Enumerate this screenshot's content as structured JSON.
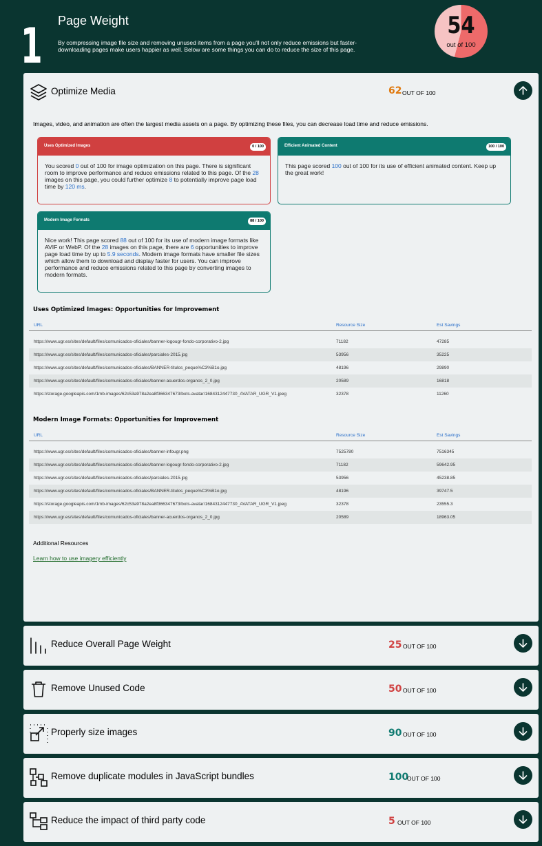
{
  "hero": {
    "number": "1",
    "title": "Page Weight",
    "description": "By compressing image file size and removing unused items from a page you'll not only reduce emissions but faster-downloading pages make users happier as well. Below are some things you can do to reduce the size of this page.",
    "score": "54",
    "score_out_of": "out of 100",
    "score_fraction": 0.54
  },
  "optimize_media": {
    "title": "Optimize Media",
    "score": "62",
    "out_of": "OUT OF 100",
    "intro": "Images, video, and animation are often the largest media assets on a page. By optimizing these files, you can decrease load time and reduce emissions.",
    "cards": [
      {
        "title": "Uses Optimized Images",
        "badge": "0 / 100",
        "parts": [
          "You scored ",
          "0",
          " out of 100 for image optimization on this page. There is significant room to improve performance and reduce emissions related to this page. Of the ",
          "28",
          " images on this page, you could further optimize ",
          "8",
          " to potentially improve page load time by ",
          "120 ms",
          "."
        ]
      },
      {
        "title": "Efficient Animated Content",
        "badge": "100 / 100",
        "parts": [
          "This page scored ",
          "100",
          " out of 100 for its use of efficient animated content. Keep up the great work!"
        ]
      },
      {
        "title": "Modern Image Formats",
        "badge": "88 / 100",
        "parts": [
          "Nice work! This page scored ",
          "88",
          " out of 100 for its use of modern image formats like AVIF or WebP. Of the ",
          "28",
          " images on this page, there are ",
          "6",
          " opportunities to improve page load time by up to ",
          "5.9 seconds",
          ". Modern image formats have smaller file sizes which allow them to download and display faster for users. You can improve performance and reduce emissions related to this page by converting images to modern formats."
        ]
      }
    ],
    "table1": {
      "title": "Uses Optimized Images: Opportunities for Improvement",
      "headers": [
        "URL",
        "Resource Size",
        "Est Savings"
      ],
      "rows": [
        [
          "https://www.ugr.es/sites/default/files/comunicados-oficiales/banner-logougr-fondo-corporativo-2.jpg",
          "71182",
          "47285"
        ],
        [
          "https://www.ugr.es/sites/default/files/comunicados-oficiales/parciales-2015.jpg",
          "53956",
          "35225"
        ],
        [
          "https://www.ugr.es/sites/default/files/comunicados-oficiales/BANNER-titulos_peque%C3%B1o.jpg",
          "48196",
          "29890"
        ],
        [
          "https://www.ugr.es/sites/default/files/comunicados-oficiales/banner-acuerdos-organos_2_0.jpg",
          "20589",
          "16818"
        ],
        [
          "https://storage.googleapis.com/1mb-images/62c53a978a2ea8f366347673/bots-avatar/1684312447730_AVATAR_UGR_V1.jpeg",
          "32378",
          "11260"
        ]
      ]
    },
    "table2": {
      "title": "Modern Image Formats: Opportunities for Improvement",
      "headers": [
        "URL",
        "Resource Size",
        "Est Savings"
      ],
      "rows": [
        [
          "https://www.ugr.es/sites/default/files/comunicados-oficiales/banner-infougr.png",
          "7525780",
          "7516345"
        ],
        [
          "https://www.ugr.es/sites/default/files/comunicados-oficiales/banner-logougr-fondo-corporativo-2.jpg",
          "71182",
          "59642.95"
        ],
        [
          "https://www.ugr.es/sites/default/files/comunicados-oficiales/parciales-2015.jpg",
          "53956",
          "45238.85"
        ],
        [
          "https://www.ugr.es/sites/default/files/comunicados-oficiales/BANNER-titulos_peque%C3%B1o.jpg",
          "48196",
          "39747.5"
        ],
        [
          "https://storage.googleapis.com/1mb-images/62c53a978a2ea8f366347673/bots-avatar/1684312447730_AVATAR_UGR_V1.jpeg",
          "32378",
          "23555.3"
        ],
        [
          "https://www.ugr.es/sites/default/files/comunicados-oficiales/banner-acuerdos-organos_2_0.jpg",
          "20589",
          "18963.05"
        ]
      ]
    },
    "additional_resources": "Additional Resources",
    "link": "Learn how to use imagery efficiently"
  },
  "sections": [
    {
      "title": "Reduce Overall Page Weight",
      "score": "25",
      "out_of": "OUT OF 100",
      "icon": "bars-icon"
    },
    {
      "title": "Remove Unused Code",
      "score": "50",
      "out_of": "OUT OF 100",
      "icon": "trash-icon"
    },
    {
      "title": "Properly size images",
      "score": "90",
      "out_of": "OUT OF 100",
      "icon": "resize-icon"
    },
    {
      "title": "Remove duplicate modules in JavaScript bundles",
      "score": "100",
      "out_of": "OUT OF 100",
      "icon": "modules-icon"
    },
    {
      "title": "Reduce the impact of third party code",
      "score": "5",
      "out_of": "OUT OF 100",
      "icon": "tree-icon"
    }
  ],
  "colors": {
    "background": "#0a3530",
    "panel": "#eef1f2",
    "score_poor": "#d04040",
    "score_average": "#e07a10",
    "score_good": "#0e7a70",
    "link_blue": "#2a6fc9",
    "card_red": "#d04040",
    "card_teal": "#0e7a70",
    "circle_light": "#f6c3c3",
    "circle_dark": "#ee6a6a"
  }
}
